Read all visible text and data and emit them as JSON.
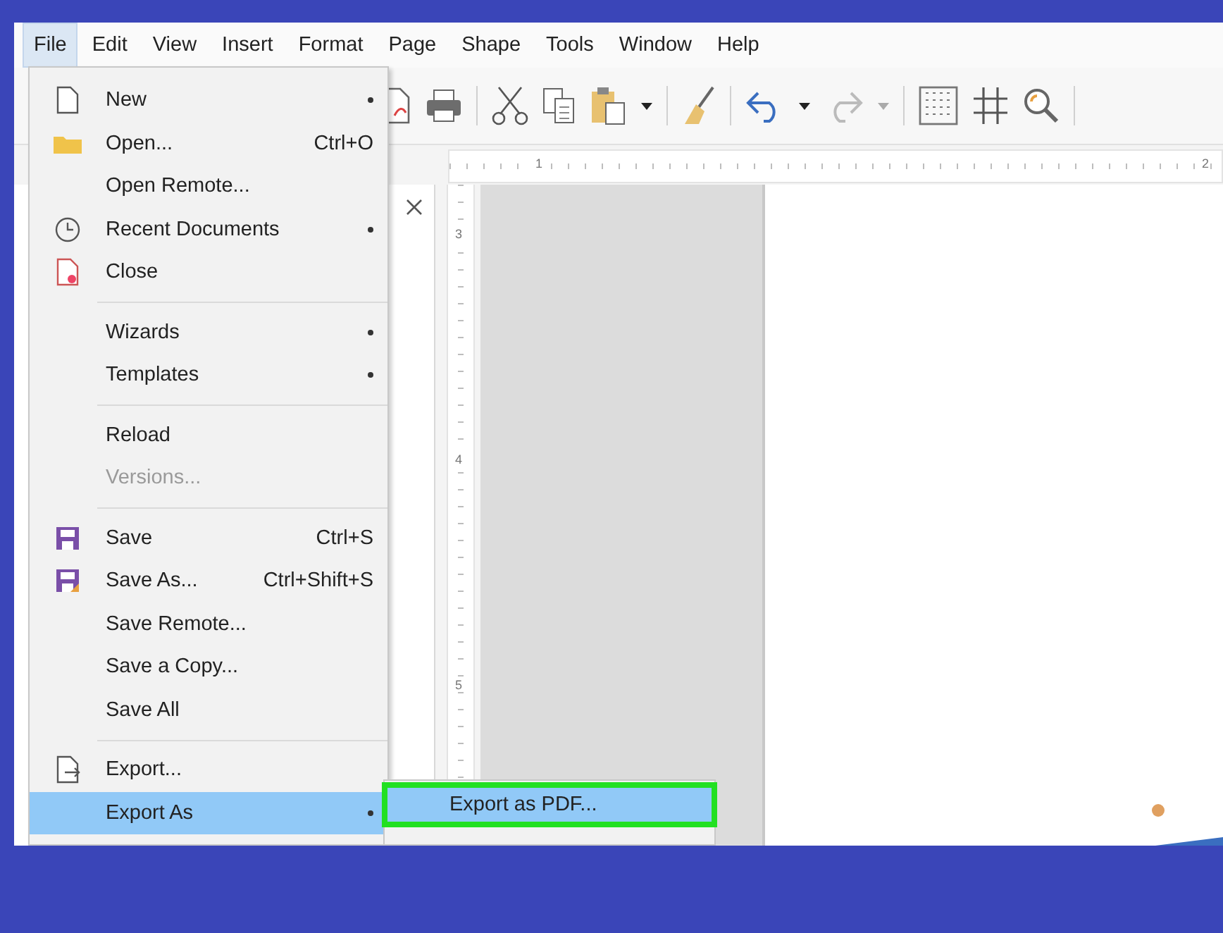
{
  "menubar": [
    {
      "label": "File",
      "selected": true
    },
    {
      "label": "Edit",
      "selected": false
    },
    {
      "label": "View",
      "selected": false
    },
    {
      "label": "Insert",
      "selected": false
    },
    {
      "label": "Format",
      "selected": false
    },
    {
      "label": "Page",
      "selected": false
    },
    {
      "label": "Shape",
      "selected": false
    },
    {
      "label": "Tools",
      "selected": false
    },
    {
      "label": "Window",
      "selected": false
    },
    {
      "label": "Help",
      "selected": false
    }
  ],
  "toolbar": [
    {
      "kind": "export-pdf"
    },
    {
      "kind": "print"
    },
    {
      "kind": "separator"
    },
    {
      "kind": "cut"
    },
    {
      "kind": "copy"
    },
    {
      "kind": "paste"
    },
    {
      "kind": "dropdown"
    },
    {
      "kind": "separator"
    },
    {
      "kind": "brush"
    },
    {
      "kind": "separator"
    },
    {
      "kind": "undo"
    },
    {
      "kind": "dropdown"
    },
    {
      "kind": "redo"
    },
    {
      "kind": "dropdown-off"
    },
    {
      "kind": "separator"
    },
    {
      "kind": "grid"
    },
    {
      "kind": "helplines"
    },
    {
      "kind": "zoom"
    },
    {
      "kind": "separator"
    }
  ],
  "rulers": {
    "horizontal": [
      "1",
      "2"
    ],
    "vertical": [
      "3",
      "4",
      "5"
    ]
  },
  "file_menu": {
    "groups": [
      [
        {
          "label": "New",
          "submenu": true,
          "disabled": false,
          "selected": false
        },
        {
          "label": "Open...",
          "shortcut": "Ctrl+O",
          "submenu": false,
          "disabled": false,
          "selected": false
        },
        {
          "label": "Open Remote...",
          "submenu": false,
          "disabled": false,
          "selected": false
        },
        {
          "label": "Recent Documents",
          "submenu": true,
          "disabled": false,
          "selected": false
        },
        {
          "label": "Close",
          "submenu": false,
          "disabled": false,
          "selected": false
        }
      ],
      [
        {
          "label": "Wizards",
          "submenu": true,
          "disabled": false,
          "selected": false
        },
        {
          "label": "Templates",
          "submenu": true,
          "disabled": false,
          "selected": false
        }
      ],
      [
        {
          "label": "Reload",
          "submenu": false,
          "disabled": false,
          "selected": false
        },
        {
          "label": "Versions...",
          "submenu": false,
          "disabled": true,
          "selected": false
        }
      ],
      [
        {
          "label": "Save",
          "shortcut": "Ctrl+S",
          "submenu": false,
          "disabled": false,
          "selected": false
        },
        {
          "label": "Save As...",
          "shortcut": "Ctrl+Shift+S",
          "submenu": false,
          "disabled": false,
          "selected": false
        },
        {
          "label": "Save Remote...",
          "submenu": false,
          "disabled": false,
          "selected": false
        },
        {
          "label": "Save a Copy...",
          "submenu": false,
          "disabled": false,
          "selected": false
        },
        {
          "label": "Save All",
          "submenu": false,
          "disabled": false,
          "selected": false
        }
      ],
      [
        {
          "label": "Export...",
          "submenu": false,
          "disabled": false,
          "selected": false
        },
        {
          "label": "Export As",
          "submenu": true,
          "disabled": false,
          "selected": true
        }
      ]
    ]
  },
  "export_submenu": {
    "items": [
      {
        "label": "Export as PDF...",
        "selected": true,
        "outlined": true
      }
    ]
  }
}
